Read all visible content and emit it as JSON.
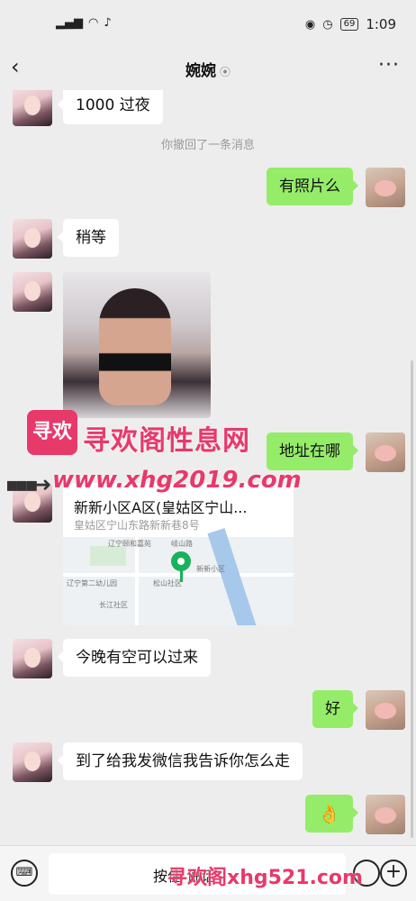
{
  "status_bar": {
    "signal": "⁵ᴳııl",
    "wifi": "≡",
    "battery": "69",
    "time": "1:09"
  },
  "header": {
    "back": "<",
    "title": "婉婉",
    "more": "···"
  },
  "messages": [
    {
      "from": "contact",
      "type": "text",
      "text": "1000 过夜"
    },
    {
      "type": "system",
      "text": "你撤回了一条消息"
    },
    {
      "from": "me",
      "type": "text",
      "text": "有照片么"
    },
    {
      "from": "contact",
      "type": "text",
      "text": "稍等"
    },
    {
      "from": "contact",
      "type": "image"
    },
    {
      "from": "me",
      "type": "text",
      "text": "地址在哪"
    },
    {
      "from": "contact",
      "type": "location",
      "name": "新新小区A区(皇姑区宁山...",
      "address": "皇姑区宁山东路新新巷8号"
    },
    {
      "from": "contact",
      "type": "text",
      "text": "今晚有空可以过来"
    },
    {
      "from": "me",
      "type": "text",
      "text": "好"
    },
    {
      "from": "contact",
      "type": "text",
      "text": "到了给我发微信我告诉你怎么走"
    },
    {
      "from": "me",
      "type": "emoji",
      "text": "👌"
    }
  ],
  "map_labels": [
    "辽宁颐和嘉苑",
    "岐山路",
    "辽宁第二幼儿园",
    "松山社区",
    "长江社区",
    "新新小区"
  ],
  "watermark": {
    "logo": "寻欢",
    "name": "寻欢阁性息网",
    "url": "www.xhg2019.com",
    "bottom": "寻欢阁xhg521.com"
  },
  "input_bar": {
    "hold_label": "按住 说话",
    "keyboard_icon": "keyboard-icon",
    "emoji_icon": "emoji-icon",
    "plus_icon": "plus-icon"
  }
}
